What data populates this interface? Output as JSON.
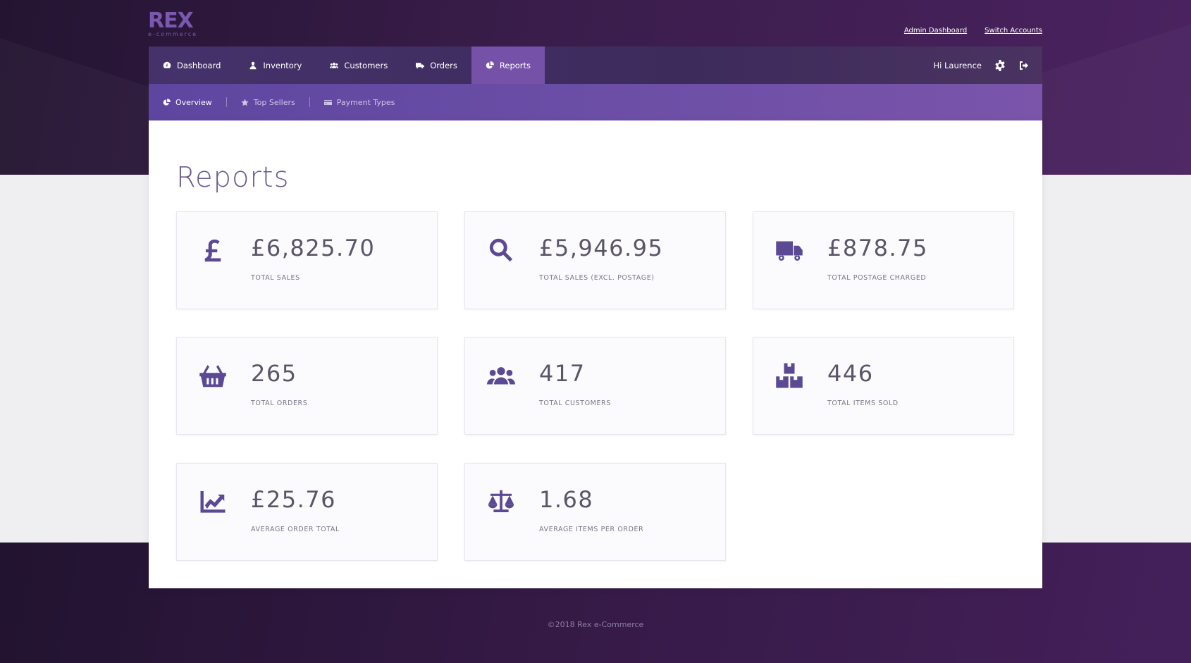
{
  "logo": {
    "main": "REX",
    "sub": "e-commerce"
  },
  "top_links": {
    "admin_dashboard": "Admin Dashboard",
    "switch_accounts": "Switch Accounts"
  },
  "nav": {
    "items": [
      {
        "label": "Dashboard",
        "icon": "dashboard-icon"
      },
      {
        "label": "Inventory",
        "icon": "inventory-icon"
      },
      {
        "label": "Customers",
        "icon": "customers-icon"
      },
      {
        "label": "Orders",
        "icon": "truck-icon"
      },
      {
        "label": "Reports",
        "icon": "pie-chart-icon",
        "active": true
      }
    ],
    "greeting": "Hi Laurence"
  },
  "subnav": {
    "items": [
      {
        "label": "Overview",
        "icon": "pie-chart-icon",
        "active": true
      },
      {
        "label": "Top Sellers",
        "icon": "star-icon"
      },
      {
        "label": "Payment Types",
        "icon": "credit-card-icon"
      }
    ]
  },
  "page": {
    "title": "Reports"
  },
  "cards": [
    {
      "value": "£6,825.70",
      "label": "TOTAL SALES",
      "icon": "pound-icon"
    },
    {
      "value": "£5,946.95",
      "label": "TOTAL SALES (EXCL. POSTAGE)",
      "icon": "search-icon"
    },
    {
      "value": "£878.75",
      "label": "TOTAL POSTAGE CHARGED",
      "icon": "truck-icon"
    },
    {
      "value": "265",
      "label": "TOTAL ORDERS",
      "icon": "basket-icon"
    },
    {
      "value": "417",
      "label": "TOTAL CUSTOMERS",
      "icon": "users-icon"
    },
    {
      "value": "446",
      "label": "TOTAL ITEMS SOLD",
      "icon": "boxes-icon"
    },
    {
      "value": "£25.76",
      "label": "AVERAGE ORDER TOTAL",
      "icon": "line-chart-icon"
    },
    {
      "value": "1.68",
      "label": "AVERAGE ITEMS PER ORDER",
      "icon": "balance-scale-icon"
    }
  ],
  "footer": {
    "text": "©2018 Rex e-Commerce"
  },
  "colors": {
    "accent": "#7552a8",
    "icon": "#5b4a93",
    "nav_bg": "#45326b"
  }
}
